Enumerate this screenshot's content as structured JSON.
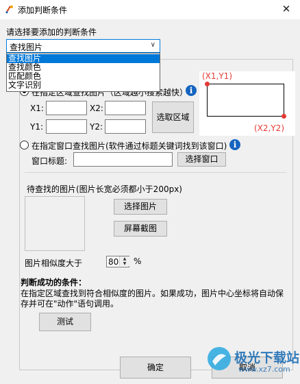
{
  "window": {
    "title": "添加判断条件",
    "close_symbol": "✕"
  },
  "prompt_label": "请选择要添加的判断条件",
  "condition_select": {
    "value": "查找图片",
    "options": [
      "查找图片",
      "查找颜色",
      "匹配颜色",
      "文字识别"
    ]
  },
  "region_option": {
    "label": "在指定区域查找图片（区域越小搜索越快）",
    "x1_label": "X1:",
    "x2_label": "X2:",
    "y1_label": "Y1:",
    "y2_label": "Y2:",
    "x1_value": "",
    "x2_value": "",
    "y1_value": "",
    "y2_value": "",
    "select_region_button": "选取区域",
    "info_icon": "i"
  },
  "diagram": {
    "top_left": "(X1,Y1)",
    "bottom_right": "(X2,Y2)"
  },
  "window_option": {
    "label": "在指定窗口查找图片(软件通过标题关键词找到该窗口)",
    "window_title_label": "窗口标题:",
    "window_title_value": "",
    "select_window_button": "选择窗口",
    "info_icon": "i"
  },
  "image_section": {
    "label": "待查找的图片(图片长宽必须都小于200px)",
    "select_image_button": "选择图片",
    "screenshot_button": "屏幕截图"
  },
  "similarity": {
    "label": "图片相似度大于",
    "value": "80",
    "unit": "%"
  },
  "success_condition": {
    "heading": "判断成功的条件：",
    "description": "在指定区域查找到符合相似度的图片。如果成功，图片中心坐标将自动保存并可在\"动作\"语句调用。"
  },
  "test_button": "测试",
  "ok_button": "确定",
  "cancel_button": "取消",
  "watermark": {
    "text": "极光下载站",
    "url": "www.xz7.com"
  },
  "colors": {
    "accent": "#0078d7",
    "info_blue": "#1565c0",
    "diagram_red": "#e53935"
  }
}
